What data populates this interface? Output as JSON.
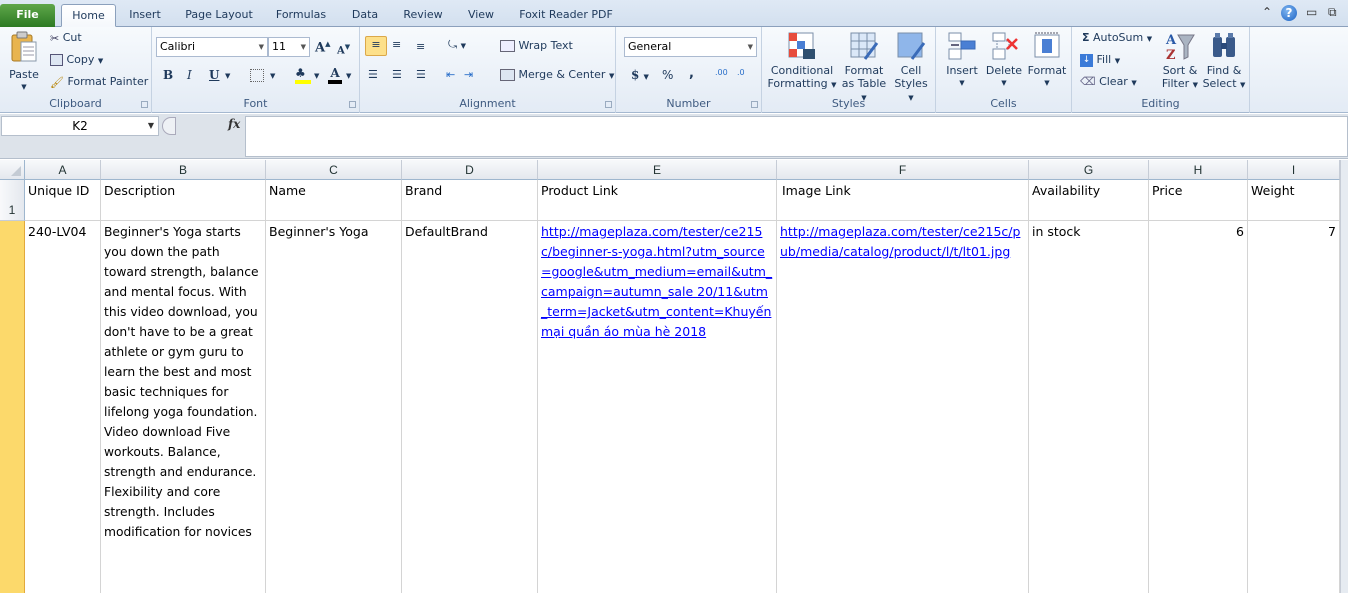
{
  "tabs": [
    {
      "label": "File"
    },
    {
      "label": "Home"
    },
    {
      "label": "Insert"
    },
    {
      "label": "Page Layout"
    },
    {
      "label": "Formulas"
    },
    {
      "label": "Data"
    },
    {
      "label": "Review"
    },
    {
      "label": "View"
    },
    {
      "label": "Foxit Reader PDF"
    }
  ],
  "active_tab": "Home",
  "ribbon": {
    "clipboard": {
      "label": "Clipboard",
      "paste": "Paste",
      "cut": "Cut",
      "copy": "Copy",
      "format_painter": "Format Painter"
    },
    "font": {
      "label": "Font",
      "font_name": "Calibri",
      "font_size": "11",
      "bold": "B",
      "italic": "I",
      "underline": "U",
      "grow": "A",
      "shrink": "A",
      "font_color": "A"
    },
    "alignment": {
      "label": "Alignment",
      "wrap_text": "Wrap Text",
      "merge_center": "Merge & Center"
    },
    "number": {
      "label": "Number",
      "format": "General",
      "currency": "$",
      "percent": "%",
      "comma": ",",
      "inc_decimal": ".00",
      "dec_decimal": ".0"
    },
    "styles": {
      "label": "Styles",
      "conditional_l1": "Conditional",
      "conditional_l2": "Formatting",
      "format_table_l1": "Format",
      "format_table_l2": "as Table",
      "cell_styles_l1": "Cell",
      "cell_styles_l2": "Styles"
    },
    "cells": {
      "label": "Cells",
      "insert": "Insert",
      "delete": "Delete",
      "format": "Format"
    },
    "editing": {
      "label": "Editing",
      "autosum": "AutoSum",
      "fill": "Fill",
      "clear": "Clear",
      "sort_l1": "Sort &",
      "sort_l2": "Filter",
      "find_l1": "Find &",
      "find_l2": "Select"
    }
  },
  "formula_bar": {
    "name_box": "K2",
    "fx": "fx",
    "formula": ""
  },
  "sheet": {
    "columns": [
      "A",
      "B",
      "C",
      "D",
      "E",
      "F",
      "G",
      "H",
      "I"
    ],
    "row_numbers": [
      "1",
      ""
    ],
    "header_row": [
      "Unique ID",
      "Description",
      "Name",
      "Brand",
      "Product Link",
      "Image Link",
      "Availability",
      "Price",
      "Weight"
    ],
    "data_row": {
      "unique_id": "240-LV04",
      "description": "Beginner's Yoga starts you down the path toward strength, balance and mental focus. With this video download, you don't have to be a great athlete or gym guru to learn the best and most basic techniques for lifelong yoga foundation. Video download Five workouts. Balance, strength and endurance. Flexibility and core strength. Includes modification for novices",
      "name": "Beginner's Yoga",
      "brand": "DefaultBrand",
      "product_link": "http://mageplaza.com/tester/ce215c/beginner-s-yoga.html?utm_source=google&utm_medium=email&utm_campaign=autumn_sale 20/11&utm_term=Jacket&utm_content=Khuyến mại quần áo mùa hè 2018",
      "image_link": "http://mageplaza.com/tester/ce215c/pub/media/catalog/product/l/t/lt01.jpg",
      "availability": "in stock",
      "price": "6",
      "weight": "7"
    }
  }
}
